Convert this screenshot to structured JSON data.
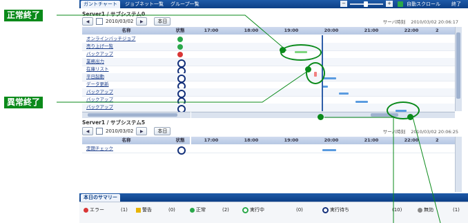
{
  "toolbar": {
    "tabs": [
      "ガントチャート",
      "ジョブネット一覧",
      "グループ一覧"
    ],
    "zoom_minus": "−",
    "zoom_plus": "+",
    "auto_scroll": "自動スクロール",
    "end": "終了"
  },
  "panel1": {
    "title": "Server1 / サブシステム0",
    "date": "2010/03/02",
    "today_button": "本日",
    "server_time_label": "サーバ時刻",
    "server_time": "2010/03/02 20:06:17",
    "col_name": "名称",
    "col_status": "状態",
    "hours": [
      "17:00",
      "18:00",
      "19:00",
      "20:00",
      "21:00",
      "22:00",
      "2"
    ],
    "jobs": [
      {
        "name": "オンラインバッチジョブ",
        "status": "ok"
      },
      {
        "name": "売り上げ一覧",
        "status": "ok"
      },
      {
        "name": "バックアップ",
        "status": "err"
      },
      {
        "name": "業務出力",
        "status": "wait"
      },
      {
        "name": "在庫リスト",
        "status": "wait"
      },
      {
        "name": "平日起動",
        "status": "wait"
      },
      {
        "name": "データ更新",
        "status": "wait"
      },
      {
        "name": "バックアップ",
        "status": "wait"
      },
      {
        "name": "バックアップ",
        "status": "wait"
      },
      {
        "name": "バックアップ",
        "status": "wait"
      }
    ]
  },
  "panel2": {
    "title": "Server1 / サブシステム5",
    "date": "2010/03/02",
    "today_button": "本日",
    "server_time_label": "サーバ時刻",
    "server_time": "2010/03/02 20:06:25",
    "col_name": "名称",
    "col_status": "状態",
    "hours": [
      "17:00",
      "18:00",
      "19:00",
      "20:00",
      "21:00",
      "22:00",
      "2"
    ],
    "jobs": [
      {
        "name": "定期チェック",
        "status": "wait"
      }
    ]
  },
  "summary": {
    "title": "本日のサマリー",
    "items": [
      {
        "label": "エラー",
        "count": "(1)",
        "color": "#d93636"
      },
      {
        "label": "警告",
        "count": "(0)",
        "color": "#e8b400"
      },
      {
        "label": "正常",
        "count": "(2)",
        "color": "#2aa84a"
      },
      {
        "label": "実行中",
        "count": "(0)",
        "color": "#2aa84a"
      },
      {
        "label": "実行待ち",
        "count": "(10)",
        "color": "#13307a"
      },
      {
        "label": "無効",
        "count": "(1)",
        "color": "#888888"
      }
    ]
  },
  "callouts": {
    "normal_end": "正常終了",
    "abnormal_end": "異常終了"
  },
  "colors": {
    "callout_green": "#0a8a1a",
    "bar_green": "#7fd67f",
    "bar_blue": "#5a9be0",
    "bar_red": "#f28080"
  }
}
